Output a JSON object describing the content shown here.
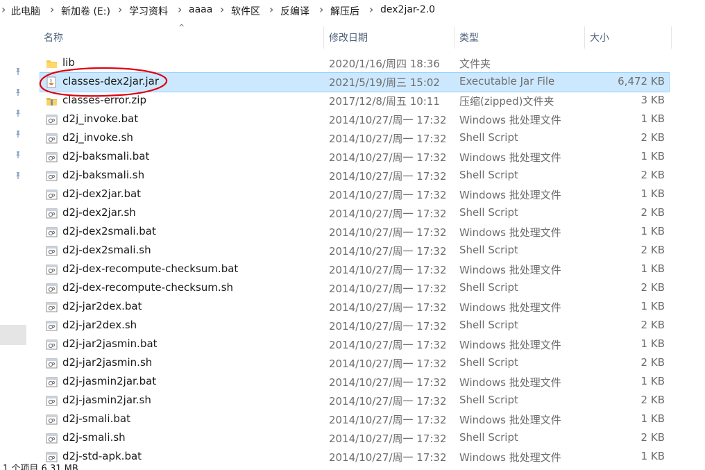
{
  "breadcrumb": [
    "此电脑",
    "新加卷 (E:)",
    "学习资料",
    "aaaa",
    "软件区",
    "反编译",
    "解压后",
    "dex2jar-2.0"
  ],
  "columns": {
    "name": "名称",
    "date": "修改日期",
    "type": "类型",
    "size": "大小"
  },
  "files": [
    {
      "name": "lib",
      "date": "2020/1/16/周四 18:36",
      "type": "文件夹",
      "size": "",
      "icon": "folder-icon"
    },
    {
      "name": "classes-dex2jar.jar",
      "date": "2021/5/19/周三 15:02",
      "type": "Executable Jar File",
      "size": "6,472 KB",
      "icon": "jar-file-icon",
      "selected": true
    },
    {
      "name": "classes-error.zip",
      "date": "2017/12/8/周五 10:11",
      "type": "压缩(zipped)文件夹",
      "size": "3 KB",
      "icon": "zip-file-icon"
    },
    {
      "name": "d2j_invoke.bat",
      "date": "2014/10/27/周一 17:32",
      "type": "Windows 批处理文件",
      "size": "1 KB",
      "icon": "script-file-icon"
    },
    {
      "name": "d2j_invoke.sh",
      "date": "2014/10/27/周一 17:32",
      "type": "Shell Script",
      "size": "2 KB",
      "icon": "script-file-icon"
    },
    {
      "name": "d2j-baksmali.bat",
      "date": "2014/10/27/周一 17:32",
      "type": "Windows 批处理文件",
      "size": "1 KB",
      "icon": "script-file-icon"
    },
    {
      "name": "d2j-baksmali.sh",
      "date": "2014/10/27/周一 17:32",
      "type": "Shell Script",
      "size": "2 KB",
      "icon": "script-file-icon"
    },
    {
      "name": "d2j-dex2jar.bat",
      "date": "2014/10/27/周一 17:32",
      "type": "Windows 批处理文件",
      "size": "1 KB",
      "icon": "script-file-icon"
    },
    {
      "name": "d2j-dex2jar.sh",
      "date": "2014/10/27/周一 17:32",
      "type": "Shell Script",
      "size": "2 KB",
      "icon": "script-file-icon"
    },
    {
      "name": "d2j-dex2smali.bat",
      "date": "2014/10/27/周一 17:32",
      "type": "Windows 批处理文件",
      "size": "1 KB",
      "icon": "script-file-icon"
    },
    {
      "name": "d2j-dex2smali.sh",
      "date": "2014/10/27/周一 17:32",
      "type": "Shell Script",
      "size": "2 KB",
      "icon": "script-file-icon"
    },
    {
      "name": "d2j-dex-recompute-checksum.bat",
      "date": "2014/10/27/周一 17:32",
      "type": "Windows 批处理文件",
      "size": "1 KB",
      "icon": "script-file-icon"
    },
    {
      "name": "d2j-dex-recompute-checksum.sh",
      "date": "2014/10/27/周一 17:32",
      "type": "Shell Script",
      "size": "2 KB",
      "icon": "script-file-icon"
    },
    {
      "name": "d2j-jar2dex.bat",
      "date": "2014/10/27/周一 17:32",
      "type": "Windows 批处理文件",
      "size": "1 KB",
      "icon": "script-file-icon"
    },
    {
      "name": "d2j-jar2dex.sh",
      "date": "2014/10/27/周一 17:32",
      "type": "Shell Script",
      "size": "2 KB",
      "icon": "script-file-icon"
    },
    {
      "name": "d2j-jar2jasmin.bat",
      "date": "2014/10/27/周一 17:32",
      "type": "Windows 批处理文件",
      "size": "1 KB",
      "icon": "script-file-icon"
    },
    {
      "name": "d2j-jar2jasmin.sh",
      "date": "2014/10/27/周一 17:32",
      "type": "Shell Script",
      "size": "2 KB",
      "icon": "script-file-icon"
    },
    {
      "name": "d2j-jasmin2jar.bat",
      "date": "2014/10/27/周一 17:32",
      "type": "Windows 批处理文件",
      "size": "1 KB",
      "icon": "script-file-icon"
    },
    {
      "name": "d2j-jasmin2jar.sh",
      "date": "2014/10/27/周一 17:32",
      "type": "Shell Script",
      "size": "2 KB",
      "icon": "script-file-icon"
    },
    {
      "name": "d2j-smali.bat",
      "date": "2014/10/27/周一 17:32",
      "type": "Windows 批处理文件",
      "size": "1 KB",
      "icon": "script-file-icon"
    },
    {
      "name": "d2j-smali.sh",
      "date": "2014/10/27/周一 17:32",
      "type": "Shell Script",
      "size": "2 KB",
      "icon": "script-file-icon"
    },
    {
      "name": "d2j-std-apk.bat",
      "date": "2014/10/27/周一 17:32",
      "type": "Windows 批处理文件",
      "size": "1 KB",
      "icon": "script-file-icon"
    }
  ],
  "status_bar": "1 个项目  6.31 MB",
  "colors": {
    "selection": "#cce8ff",
    "selection_border": "#99d1ff",
    "annotation": "#e0000e",
    "header_text": "#4c607a"
  }
}
